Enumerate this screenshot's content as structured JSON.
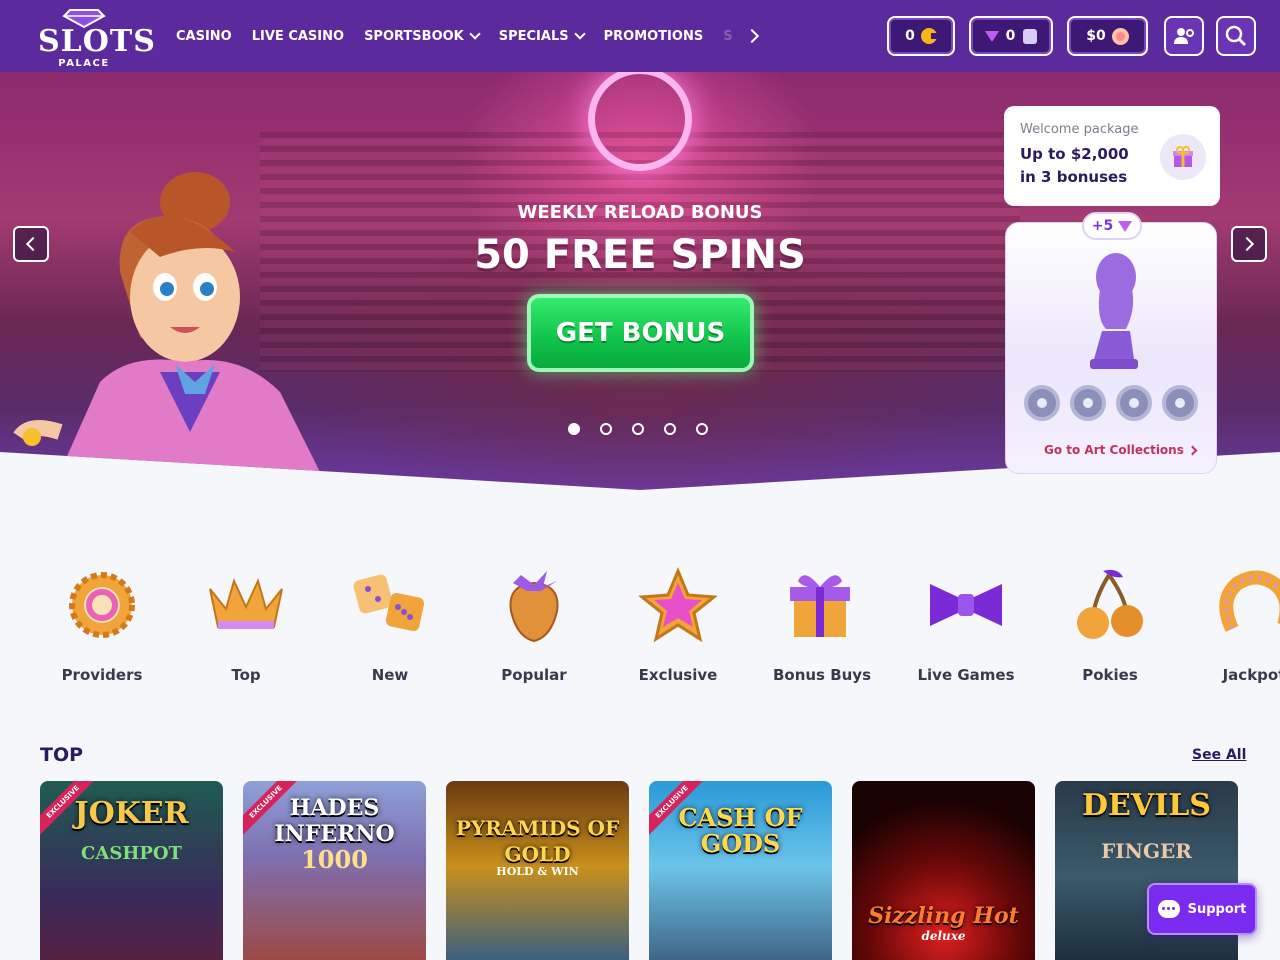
{
  "header": {
    "logo_text": "SLOTS",
    "logo_sub": "PALACE",
    "nav": [
      {
        "label": "CASINO",
        "dropdown": false
      },
      {
        "label": "LIVE CASINO",
        "dropdown": false
      },
      {
        "label": "SPORTSBOOK",
        "dropdown": true
      },
      {
        "label": "SPECIALS",
        "dropdown": true
      },
      {
        "label": "PROMOTIONS",
        "dropdown": false
      }
    ],
    "nav_overflow": "S",
    "coins_value": "0",
    "gems_value": "0",
    "balance_value": "$0"
  },
  "hero": {
    "subtitle": "WEEKLY RELOAD BONUS",
    "title": "50 FREE SPINS",
    "cta_label": "GET BONUS",
    "slides_total": 5,
    "active_slide": 1
  },
  "welcome": {
    "label": "Welcome package",
    "text": "Up to $2,000 in 3 bonuses"
  },
  "art": {
    "badge": "+5",
    "link_label": "Go to Art Collections"
  },
  "categories": [
    {
      "label": "Providers",
      "icon": "gear-icon"
    },
    {
      "label": "Top",
      "icon": "crown-icon"
    },
    {
      "label": "New",
      "icon": "dice-icon"
    },
    {
      "label": "Popular",
      "icon": "strawberry-icon"
    },
    {
      "label": "Exclusive",
      "icon": "star-icon"
    },
    {
      "label": "Bonus Buys",
      "icon": "gift-icon"
    },
    {
      "label": "Live Games",
      "icon": "bowtie-icon"
    },
    {
      "label": "Pokies",
      "icon": "cherries-icon"
    },
    {
      "label": "Jackpot",
      "icon": "horseshoe-icon"
    }
  ],
  "top": {
    "title": "TOP",
    "see_all": "See All",
    "games": [
      {
        "title": "JOKER",
        "sub": "CASHPOT",
        "exclusive": true
      },
      {
        "title": "HADES INFERNO",
        "sub": "1000",
        "exclusive": true
      },
      {
        "title": "PYRAMIDS OF GOLD",
        "sub": "HOLD & WIN",
        "exclusive": false
      },
      {
        "title": "CASH OF GODS",
        "sub": "",
        "exclusive": true
      },
      {
        "title": "Sizzling Hot",
        "sub": "deluxe",
        "exclusive": false
      },
      {
        "title": "DEVILS",
        "sub": "FINGER",
        "exclusive": false
      }
    ],
    "exclusive_label": "EXCLUSIVE"
  },
  "support": {
    "label": "Support"
  },
  "colors": {
    "header": "#5b2a9c",
    "cta": "#14c84c",
    "accent": "#c05cf2"
  }
}
